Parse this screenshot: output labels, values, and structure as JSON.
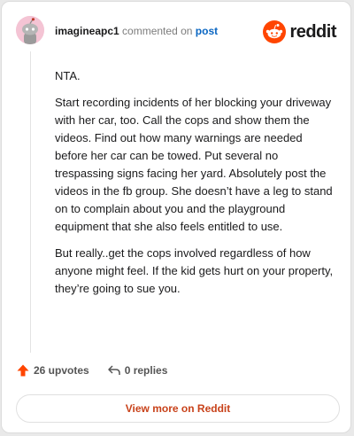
{
  "comment": {
    "username": "imagineapc1",
    "action_text": "commented on",
    "post_link_text": "post",
    "paragraphs": [
      "NTA.",
      "Start recording incidents of her blocking your driveway with her car, too. Call the cops and show them the videos. Find out how many warnings are needed before her car can be towed. Put several no trespassing signs facing her yard. Absolutely post the videos in the fb group. She doesn’t have a leg to stand on to complain about you and the playground equipment that she also feels entitled to use.",
      "But really..get the cops involved regardless of how anyone might feel. If the kid gets hurt on your property, they’re going to sue you."
    ],
    "upvotes_text": "26 upvotes",
    "replies_text": "0 replies"
  },
  "brand": {
    "wordmark": "reddit",
    "icon": "reddit-snoo-icon",
    "accent": "#ff4500"
  },
  "footer": {
    "view_more_label": "View more on Reddit"
  },
  "icons": {
    "upvote": "upvote-arrow-icon",
    "reply": "reply-arrow-icon",
    "avatar": "avatar"
  },
  "colors": {
    "upvote": "#ff4500",
    "link": "#0a66c2",
    "view_more": "#c8421a"
  }
}
